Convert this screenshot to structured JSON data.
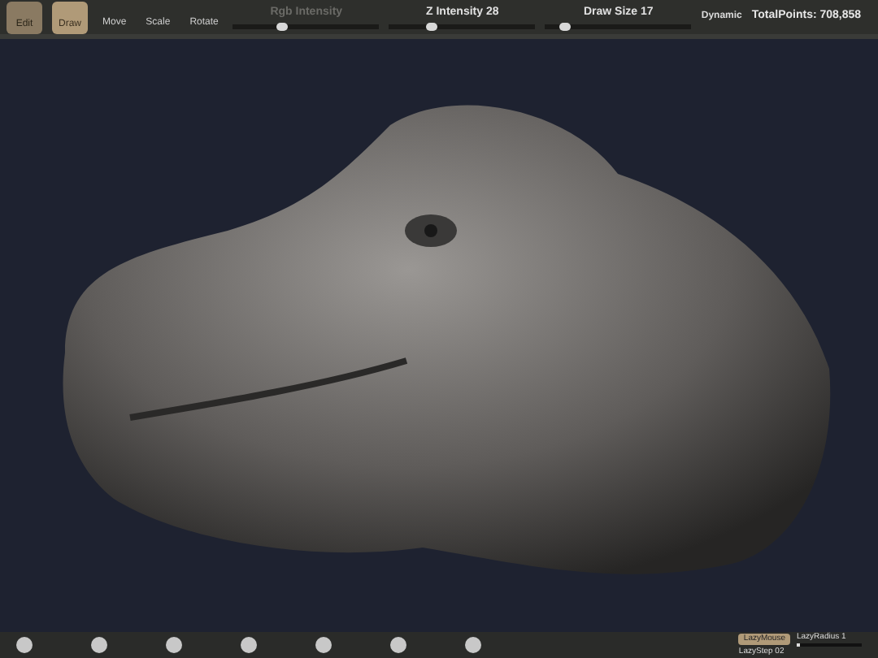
{
  "toolbar": {
    "modes": [
      {
        "label": "Edit",
        "selected": false
      },
      {
        "label": "Draw",
        "selected": true
      }
    ],
    "transforms": [
      {
        "label": "Move"
      },
      {
        "label": "Scale"
      },
      {
        "label": "Rotate"
      }
    ],
    "sliders": [
      {
        "label": "Rgb Intensity",
        "level": 0.3,
        "disabled": true
      },
      {
        "label": "Z Intensity 28",
        "level": 0.25,
        "disabled": false
      },
      {
        "label": "Draw Size 17",
        "level": 0.1,
        "disabled": false
      }
    ],
    "dynamic": "Dynamic",
    "total_points": "TotalPoints: 708,858"
  },
  "bottom_shelf": {
    "lazy_mouse": {
      "label": "LazyMouse",
      "on": true
    },
    "lazy_radius": {
      "label": "LazyRadius 1",
      "level": 0.05
    },
    "lazy_step": "LazyStep 02"
  }
}
